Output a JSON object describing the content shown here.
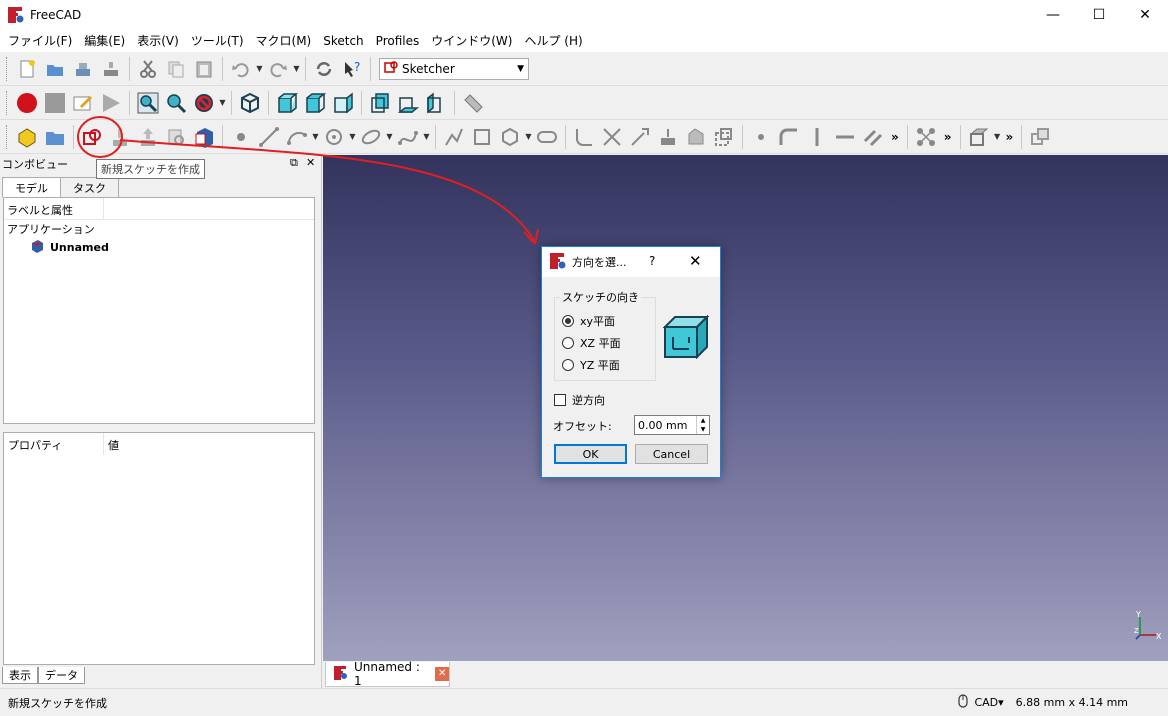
{
  "window": {
    "title": "FreeCAD",
    "minimize": "—",
    "maximize": "☐",
    "close": "✕"
  },
  "menu": {
    "items": [
      "ファイル(F)",
      "編集(E)",
      "表示(V)",
      "ツール(T)",
      "マクロ(M)",
      "Sketch",
      "Profiles",
      "ウインドウ(W)",
      "ヘルプ (H)"
    ]
  },
  "toolbar": {
    "workbench": "Sketcher",
    "more": "»"
  },
  "tooltip": {
    "text": "新規スケッチを作成"
  },
  "combo": {
    "title": "コンボビュー",
    "tabs": [
      "モデル",
      "タスク"
    ],
    "tree_header": "ラベルと属性",
    "tree_root": "アプリケーション",
    "tree_doc": "Unnamed",
    "props_col1": "プロパティ",
    "props_col2": "値",
    "bottom_tabs": [
      "表示",
      "データ"
    ]
  },
  "dialog": {
    "title": "方向を選...",
    "help": "?",
    "close": "✕",
    "group_title": "スケッチの向き",
    "radio": [
      {
        "label": "xy平面",
        "selected": true
      },
      {
        "label": "XZ 平面",
        "selected": false
      },
      {
        "label": "YZ 平面",
        "selected": false
      }
    ],
    "reverse_label": "逆方向",
    "reverse_checked": false,
    "offset_label": "オフセット:",
    "offset_value": "0.00 mm",
    "ok": "OK",
    "cancel": "Cancel"
  },
  "document_tab": {
    "label": "Unnamed : 1",
    "close": "✕"
  },
  "statusbar": {
    "message": "新規スケッチを作成",
    "nav_style": "CAD▾",
    "dimensions": "6.88 mm x 4.14 mm"
  },
  "axes": {
    "x": "X",
    "y": "Y",
    "z": "Z"
  },
  "colors": {
    "accent": "#0078d7",
    "annotation": "#e02020",
    "view_top": "#33335e",
    "view_bottom": "#a0a0bf"
  }
}
